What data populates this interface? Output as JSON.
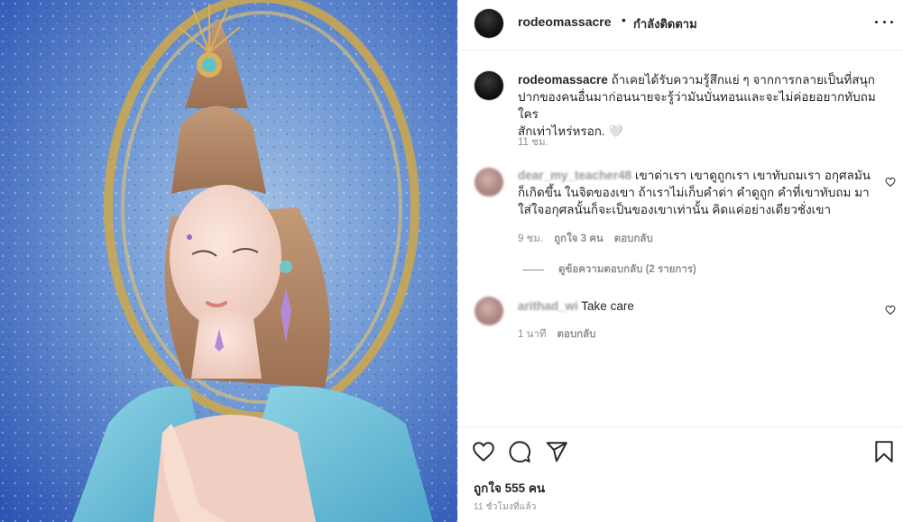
{
  "post": {
    "author": "rodeomassacre",
    "dot": "•",
    "follow_status": "กำลังติดตาม",
    "more_icon": "more-options-icon",
    "caption": {
      "username": "rodeomassacre",
      "line1": "ถ้าเคยได้รับความรู้สึกแย่ ๆ จากการกลายเป็นที่สนุก",
      "line2": "ปากของคนอื่นมาก่อนนายจะรู้ว่ามันบั่นทอนและจะไม่ค่อยอยากทับถม ใคร",
      "line3": "สักเท่าไหร่หรอก. 🤍",
      "time": "11 ชม."
    },
    "comments": [
      {
        "username": "dear_my_teacher48",
        "line1": "เขาด่าเรา เขาดูถูกเรา เขาทับถมเรา อกุศลมัน",
        "line2": "ก็เกิดขึ้น ในจิตของเขา ถ้าเราไม่เก็บคำด่า คำดูถูก คำที่เขาทับถม มา",
        "line3": "ใส่ใจอกุศลนั้นก็จะเป็นของเขาเท่านั้น คิดแค่อย่างเดียวชั่งเขา",
        "time": "9 ชม.",
        "likes": "ถูกใจ 3 คน",
        "reply": "ตอบกลับ",
        "view_replies": "ดูข้อความตอบกลับ (2 รายการ)"
      },
      {
        "username": "arithad_wi",
        "text": "Take care",
        "time": "1 นาที",
        "reply": "ตอบกลับ"
      }
    ],
    "actions": {
      "like_icon": "heart-icon",
      "comment_icon": "comment-icon",
      "share_icon": "share-icon",
      "save_icon": "bookmark-icon"
    },
    "likes_text": "ถูกใจ 555 คน",
    "timestamp": "11 ชั่วโมงที่แล้ว"
  }
}
